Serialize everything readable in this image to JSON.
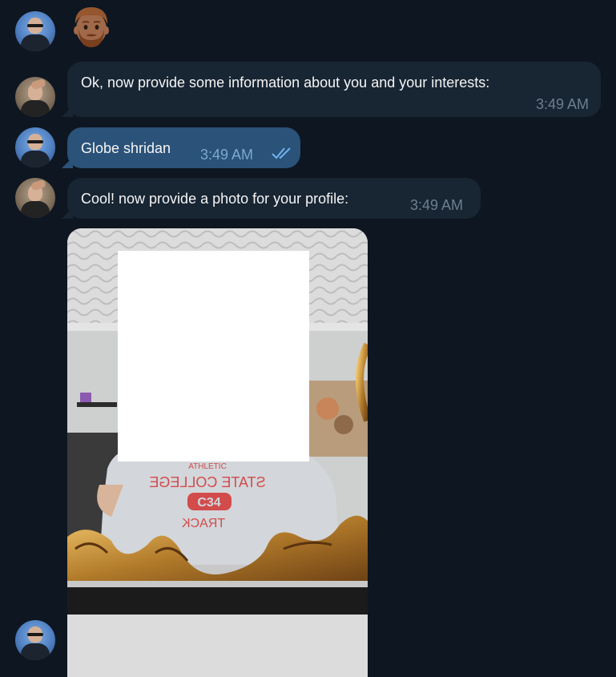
{
  "colors": {
    "background": "#0e1621",
    "incoming_bubble": "#182533",
    "outgoing_bubble": "#2b5278",
    "incoming_time": "#6d7f8f",
    "outgoing_time": "#7da8d3",
    "read_checks": "#6db3f2"
  },
  "messages": [
    {
      "sender": "user",
      "type": "emoji",
      "emoji": "man-medium-skin-tone-beard-emoji"
    },
    {
      "sender": "bot",
      "type": "text",
      "text": "Ok, now provide some information about you and your interests:",
      "time": "3:49 AM"
    },
    {
      "sender": "user",
      "type": "text",
      "text": "Globe shridan",
      "time": "3:49 AM",
      "status": "read-checks-icon"
    },
    {
      "sender": "bot",
      "type": "text",
      "text": "Cool! now provide a photo for your profile:",
      "time": "3:49 AM"
    },
    {
      "sender": "user",
      "type": "photo",
      "photo_text": [
        "ATHLETIC",
        "STATE COLLEGE",
        "C34",
        "TRACK"
      ]
    }
  ]
}
